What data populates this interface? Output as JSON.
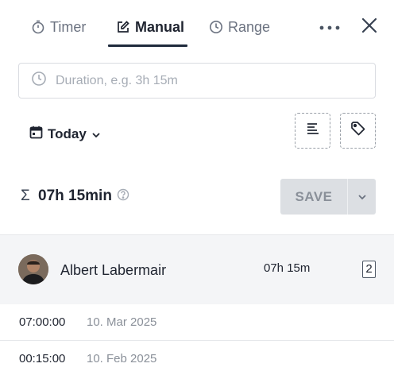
{
  "tabs": {
    "timer": {
      "label": "Timer",
      "icon": "stopwatch-icon"
    },
    "manual": {
      "label": "Manual",
      "icon": "edit-icon",
      "active": true
    },
    "range": {
      "label": "Range",
      "icon": "clock-icon"
    }
  },
  "toolbar": {
    "more_icon": "more-horizontal-icon",
    "close_icon": "close-icon"
  },
  "duration": {
    "placeholder": "Duration, e.g. 3h 15m",
    "value": "",
    "icon": "clock-icon"
  },
  "date_picker": {
    "label": "Today",
    "icon": "calendar-icon"
  },
  "actions": {
    "description_icon": "align-left-icon",
    "tag_icon": "tag-icon"
  },
  "summary": {
    "sigma": "Σ",
    "total": "07h 15min",
    "help_icon": "help-circle-icon"
  },
  "save": {
    "label": "SAVE",
    "caret_icon": "chevron-down-icon"
  },
  "user": {
    "name": "Albert Labermair",
    "total": "07h 15m",
    "count": "2"
  },
  "entries": [
    {
      "duration": "07:00:00",
      "date": "10. Mar 2025"
    },
    {
      "duration": "00:15:00",
      "date": "10. Feb 2025"
    }
  ],
  "colors": {
    "accent": "#1f2a3c",
    "text": "#1f2430",
    "muted": "#8a9099",
    "save_bg": "#dcdfe3",
    "row_bg": "#f4f5f7"
  }
}
